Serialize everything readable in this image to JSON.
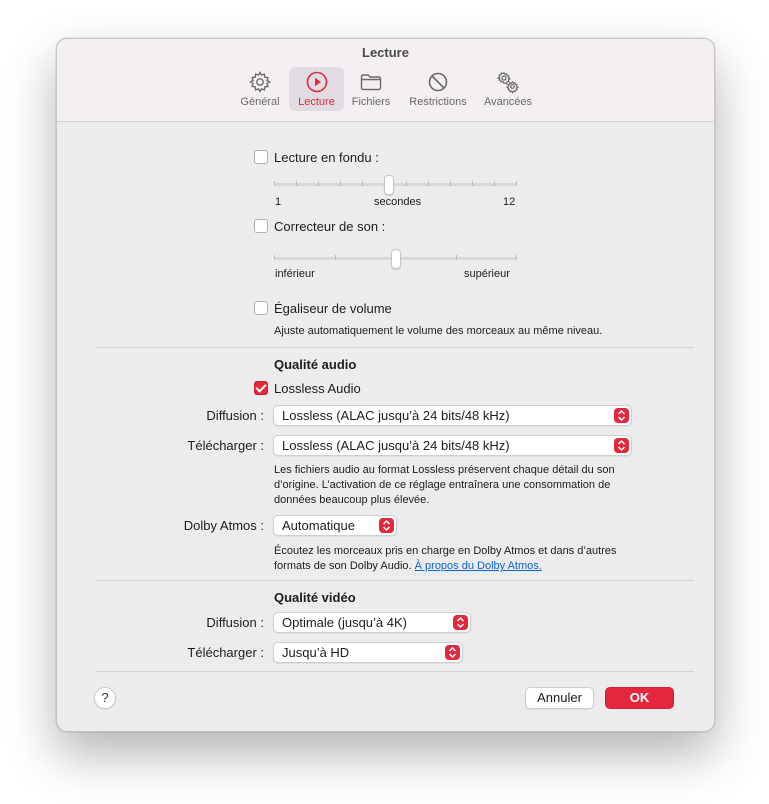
{
  "window": {
    "title": "Lecture"
  },
  "tabs": [
    {
      "label": "Général",
      "icon": "gear-icon",
      "active": false
    },
    {
      "label": "Lecture",
      "icon": "play-circle-icon",
      "active": true
    },
    {
      "label": "Fichiers",
      "icon": "folder-icon",
      "active": false
    },
    {
      "label": "Restrictions",
      "icon": "prohibited-icon",
      "active": false
    },
    {
      "label": "Avancées",
      "icon": "gears-icon",
      "active": false
    }
  ],
  "crossfade": {
    "label": "Lecture en fondu :",
    "checked": false,
    "min_label": "1",
    "unit_label": "secondes",
    "max_label": "12",
    "value": 6
  },
  "sound_enhancer": {
    "label": "Correcteur de son :",
    "checked": false,
    "low_label": "inférieur",
    "high_label": "supérieur",
    "value": 0.5
  },
  "sound_check": {
    "label": "Égaliseur de volume",
    "checked": false,
    "description": "Ajuste automatiquement le volume des morceaux au même niveau."
  },
  "audio_quality": {
    "heading": "Qualité audio",
    "lossless": {
      "label": "Lossless Audio",
      "checked": true
    },
    "streaming": {
      "label": "Diffusion :",
      "value": "Lossless (ALAC jusqu’à 24 bits/48 kHz)"
    },
    "download": {
      "label": "Télécharger :",
      "value": "Lossless (ALAC jusqu’à 24 bits/48 kHz)"
    },
    "lossless_description_lines": [
      "Les fichiers audio au format Lossless préservent chaque détail du son",
      "d’origine. L’activation de ce réglage entraînera une consommation de",
      "données beaucoup plus élevée."
    ],
    "dolby": {
      "label": "Dolby Atmos :",
      "value": "Automatique"
    },
    "dolby_description_line1": "Écoutez les morceaux pris en charge en Dolby Atmos et dans d’autres",
    "dolby_description_line2": "formats de son Dolby Audio.",
    "dolby_link": "À propos du Dolby Atmos."
  },
  "video_quality": {
    "heading": "Qualité vidéo",
    "streaming": {
      "label": "Diffusion :",
      "value": "Optimale (jusqu’à 4K)"
    },
    "download": {
      "label": "Télécharger :",
      "value": "Jusqu’à HD"
    }
  },
  "footer": {
    "help": "?",
    "cancel": "Annuler",
    "ok": "OK"
  },
  "colors": {
    "accent": "#e3283d",
    "link": "#0a63d6",
    "window_bg": "#ececec"
  }
}
